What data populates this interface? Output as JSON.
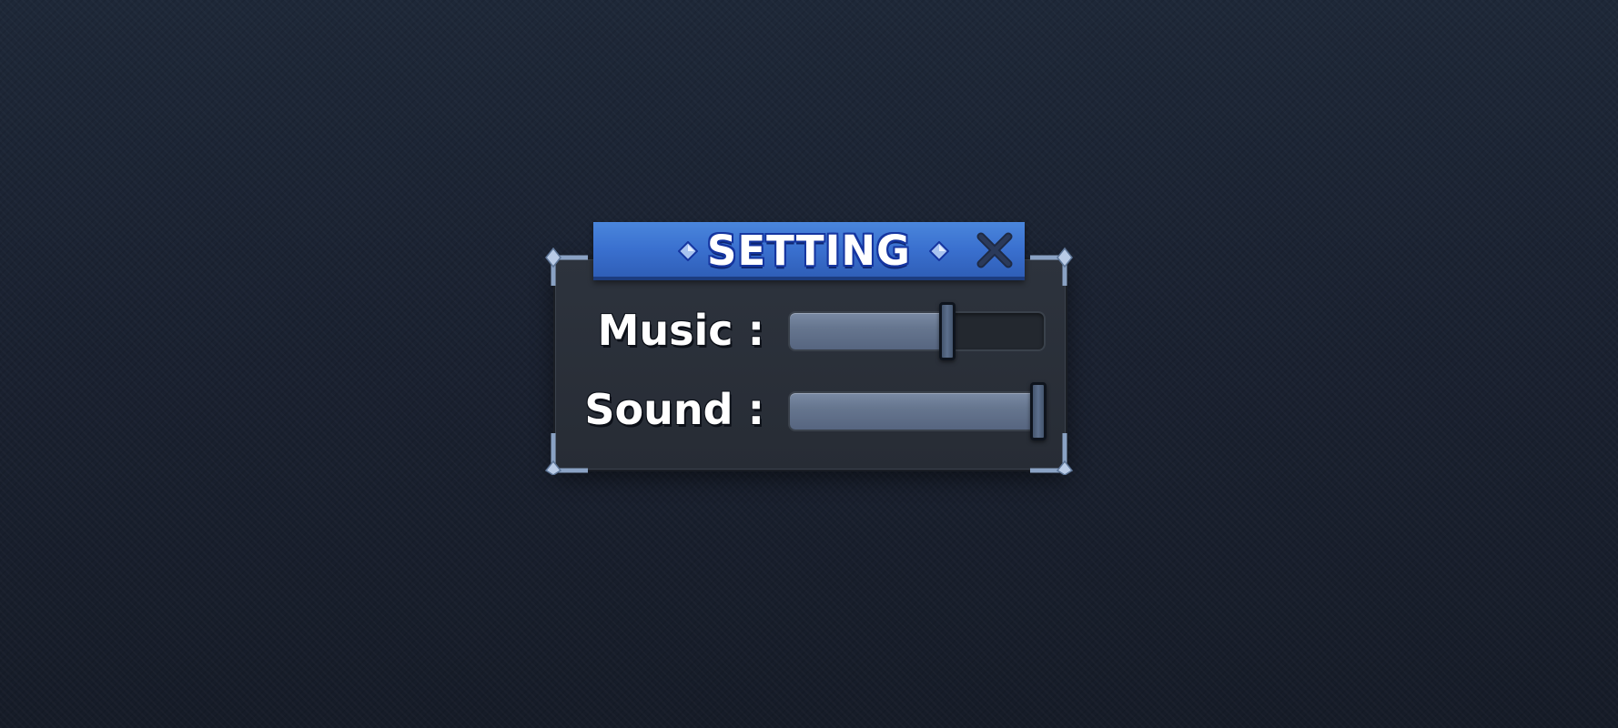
{
  "dialog": {
    "title": "SETTING",
    "close_icon": "close-x-icon",
    "title_gem_icon": "diamond-gem-icon"
  },
  "settings": {
    "music": {
      "label": "Music :",
      "level": 0.62
    },
    "sound": {
      "label": "Sound :",
      "level": 0.98
    }
  },
  "colors": {
    "title_banner": "#3a70cf",
    "title_outline": "#1535a0",
    "panel_bg": "#2a2f38",
    "slider_fill": "#66768f",
    "close_icon": "#1e2a44",
    "corner_frame": "#8aa2c4"
  }
}
